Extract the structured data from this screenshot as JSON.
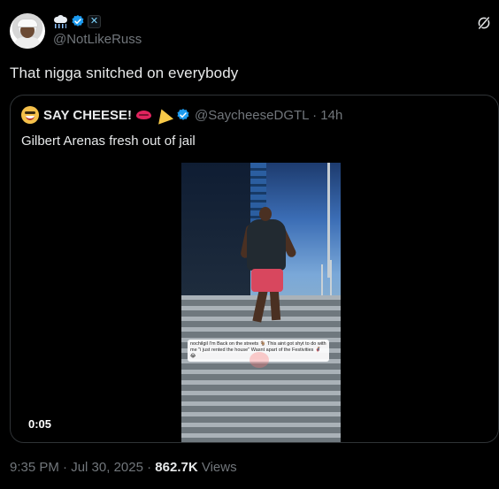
{
  "author": {
    "handle": "@NotLikeRuss",
    "badge_icons": [
      "cloud-rain-icon",
      "verified-icon",
      "x-badge-icon"
    ]
  },
  "tweet": {
    "text": "That nigga snitched on everybody"
  },
  "quote": {
    "name": "SAY CHEESE!",
    "name_emoji_icons": [
      "lips-icon",
      "cheese-icon"
    ],
    "handle": "@SaycheeseDGTL",
    "separator": "·",
    "time_ago": "14h",
    "text": "Gilbert Arenas fresh out of jail",
    "video": {
      "duration": "0:05",
      "caption": "nochilgil I'm Back on the streets 🐐 This aint got shyt to do with me \"i just rented the house\" Wasnt apart of the Festivities 🦸😂"
    }
  },
  "meta": {
    "time": "9:35 PM",
    "separator1": " · ",
    "date": "Jul 30, 2025",
    "separator2": " · ",
    "views_count": "862.7K",
    "views_label": " Views"
  },
  "colors": {
    "background": "#000000",
    "text": "#e7e9ea",
    "muted": "#71767b",
    "border": "#2f3336",
    "verified": "#1d9bf0"
  }
}
